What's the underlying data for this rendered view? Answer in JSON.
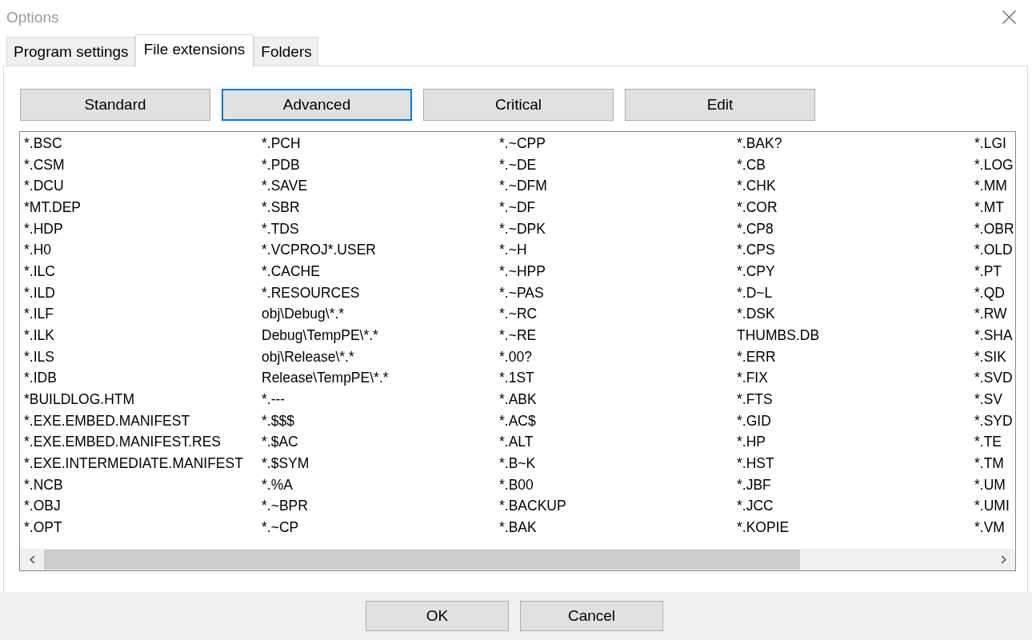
{
  "window": {
    "title": "Options"
  },
  "tabs": [
    {
      "label": "Program settings",
      "selected": false
    },
    {
      "label": "File extensions",
      "selected": true
    },
    {
      "label": "Folders",
      "selected": false
    }
  ],
  "category_buttons": [
    {
      "label": "Standard",
      "selected": false
    },
    {
      "label": "Advanced",
      "selected": true
    },
    {
      "label": "Critical",
      "selected": false
    },
    {
      "label": "Edit",
      "selected": false
    }
  ],
  "extension_list": {
    "columns": [
      [
        "*.BSC",
        "*.CSM",
        "*.DCU",
        "*MT.DEP",
        "*.HDP",
        "*.H0",
        "*.ILC",
        "*.ILD",
        "*.ILF",
        "*.ILK",
        "*.ILS",
        "*.IDB",
        "*BUILDLOG.HTM",
        "*.EXE.EMBED.MANIFEST",
        "*.EXE.EMBED.MANIFEST.RES",
        "*.EXE.INTERMEDIATE.MANIFEST",
        "*.NCB",
        "*.OBJ",
        "*.OPT"
      ],
      [
        "*.PCH",
        "*.PDB",
        "*.SAVE",
        "*.SBR",
        "*.TDS",
        "*.VCPROJ*.USER",
        "*.CACHE",
        "*.RESOURCES",
        "obj\\Debug\\*.*",
        "Debug\\TempPE\\*.*",
        "obj\\Release\\*.*",
        "Release\\TempPE\\*.*",
        "*.---",
        "*.$$$",
        "*.$AC",
        "*.$SYM",
        "*.%A",
        "*.~BPR",
        "*.~CP"
      ],
      [
        "*.~CPP",
        "*.~DE",
        "*.~DFM",
        "*.~DF",
        "*.~DPK",
        "*.~H",
        "*.~HPP",
        "*.~PAS",
        "*.~RC",
        "*.~RE",
        "*.00?",
        "*.1ST",
        "*.ABK",
        "*.AC$",
        "*.ALT",
        "*.B~K",
        "*.B00",
        "*.BACKUP",
        "*.BAK"
      ],
      [
        "*.BAK?",
        "*.CB",
        "*.CHK",
        "*.COR",
        "*.CP8",
        "*.CPS",
        "*.CPY",
        "*.D~L",
        "*.DSK",
        "THUMBS.DB",
        "*.ERR",
        "*.FIX",
        "*.FTS",
        "*.GID",
        "*.HP",
        "*.HST",
        "*.JBF",
        "*.JCC",
        "*.KOPIE"
      ],
      [
        "*.LGI",
        "*.LOG",
        "*.MM",
        "*.MT",
        "*.OBR",
        "*.OLD",
        "*.PT",
        "*.QD",
        "*.RW",
        "*.SHA",
        "*.SIK",
        "*.SVD",
        "*.SV",
        "*.SYD",
        "*.TE",
        "*.TM",
        "*.UM",
        "*.UMI",
        "*.VM"
      ]
    ]
  },
  "dialog_buttons": [
    "OK",
    "Cancel"
  ]
}
